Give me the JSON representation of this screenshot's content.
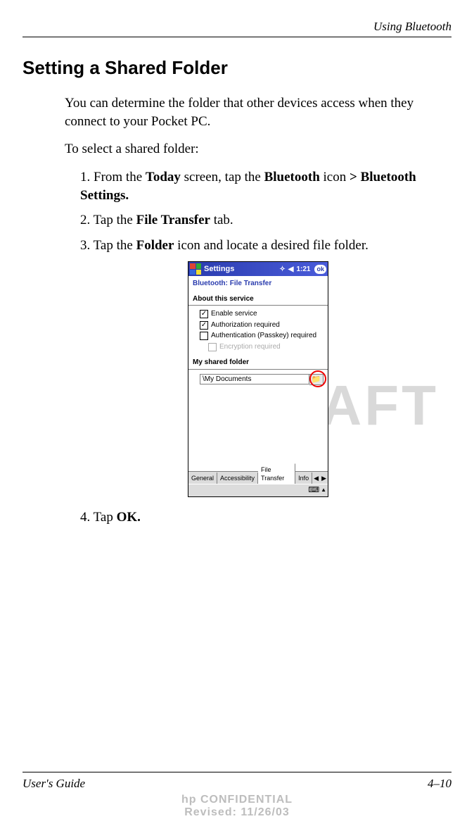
{
  "header": {
    "running_head": "Using Bluetooth"
  },
  "section": {
    "title": "Setting a Shared Folder",
    "intro": "You can determine the folder that other devices access when they connect to your Pocket PC.",
    "lead": "To select a shared folder:",
    "steps": {
      "s1_pre": "1. From the ",
      "s1_b1": "Today",
      "s1_mid1": " screen, tap the ",
      "s1_b2": "Bluetooth",
      "s1_mid2": " icon ",
      "s1_b3": "> Bluetooth Settings.",
      "s2_pre": "2. Tap the ",
      "s2_b1": "File Transfer",
      "s2_post": " tab.",
      "s3_pre": "3. Tap the ",
      "s3_b1": "Folder",
      "s3_post": " icon and locate a desired file folder.",
      "s4_pre": "4. Tap ",
      "s4_b1": "OK."
    }
  },
  "screenshot": {
    "titlebar": {
      "title": "Settings",
      "time": "1:21",
      "ok": "ok"
    },
    "subtitle": "Bluetooth: File Transfer",
    "about_label": "About this service",
    "checks": {
      "enable": {
        "checked": true,
        "label": "Enable service"
      },
      "auth": {
        "checked": true,
        "label": "Authorization required"
      },
      "passkey": {
        "checked": false,
        "label": "Authentication (Passkey) required"
      },
      "encrypt": {
        "checked": false,
        "label": "Encryption required",
        "disabled": true
      }
    },
    "shared_label": "My shared folder",
    "shared_value": "\\My Documents",
    "folder_icon": "📁",
    "tabs": {
      "general": "General",
      "accessibility": "Accessibility",
      "file_transfer": "File Transfer",
      "info": "Info"
    },
    "kbd": "⌨",
    "tri": "▲",
    "left": "◀",
    "right": "▶"
  },
  "watermark": "DRAFT",
  "footer": {
    "guide": "User's Guide",
    "page": "4–10",
    "conf1": "hp CONFIDENTIAL",
    "conf2": "Revised: 11/26/03"
  }
}
